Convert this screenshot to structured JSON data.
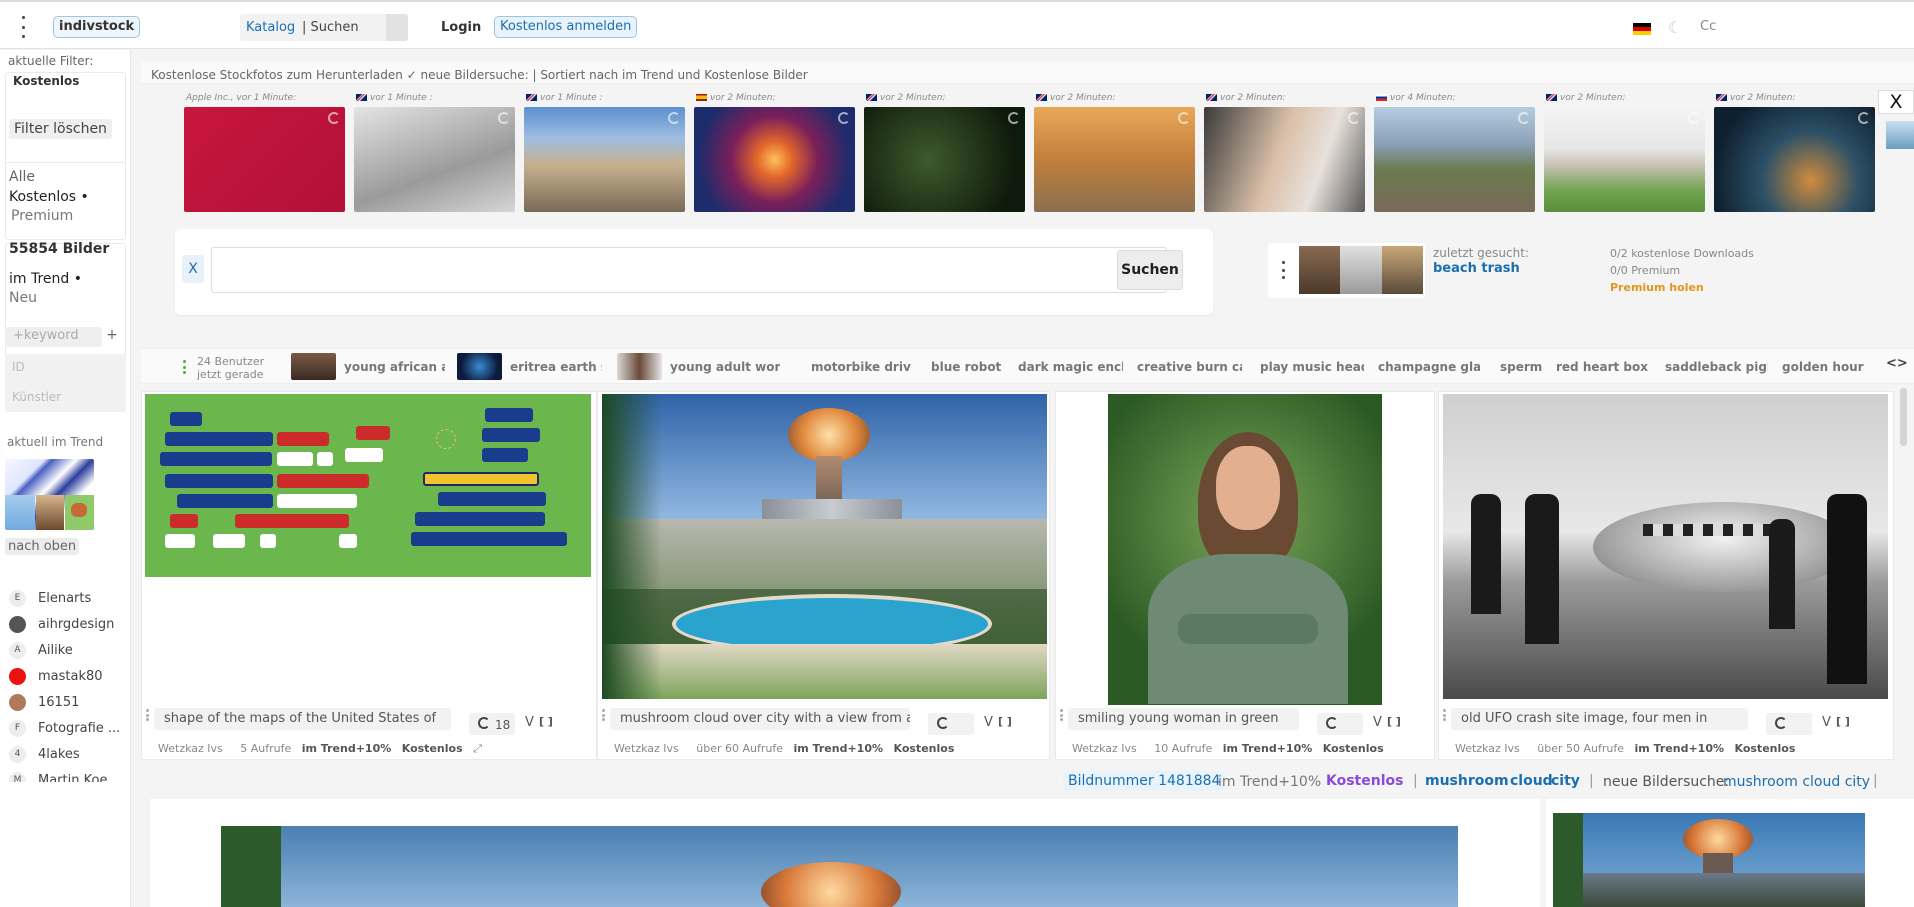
{
  "topbar": {
    "logo": "indivstock",
    "catalog_label": "Katalog",
    "search_label": "| Suchen",
    "login_label": "Login",
    "signup_label": "Kostenlos anmelden",
    "theme_icon": "moon-icon",
    "cc_label": "Cc",
    "flag_colors": [
      "#000000",
      "#dd0000",
      "#ffce00"
    ]
  },
  "sidebar": {
    "filter_title": "aktuelle Filter:",
    "filter_value": "Kostenlos",
    "filter_clear": "Filter löschen",
    "types": [
      "Alle",
      "Kostenlos •",
      "Premium"
    ],
    "count": "55854 Bilder",
    "sorts": [
      "im Trend •",
      "Neu"
    ],
    "keyword_placeholder": "+keyword",
    "plus": "+",
    "id_placeholder": "ID",
    "artist_placeholder": "Künstler",
    "trend_label": "aktuell im Trend",
    "to_top": "nach oben",
    "artists": [
      {
        "initial": "E",
        "name": "Elenarts",
        "color": "#ededed"
      },
      {
        "initial": "",
        "name": "aihrgdesign",
        "color": "#555555"
      },
      {
        "initial": "A",
        "name": "Ailike",
        "color": "#ededed"
      },
      {
        "initial": "",
        "name": "mastak80",
        "color": "#ee1111"
      },
      {
        "initial": "",
        "name": "16151",
        "color": "#b07a5a"
      },
      {
        "initial": "F",
        "name": "Fotografie ...",
        "color": "#ededed"
      },
      {
        "initial": "4",
        "name": "4lakes",
        "color": "#ededed"
      },
      {
        "initial": "M",
        "name": "Martin Koe...",
        "color": "#ededed"
      }
    ]
  },
  "main": {
    "head_text": "Kostenlose Stockfotos zum Herunterladen ✓ neue Bildersuche: | Sortiert nach im Trend und Kostenlose Bilder"
  },
  "recent": [
    {
      "caption": "Apple Inc., vor 1 Minute:",
      "flag": "",
      "bg": "linear-gradient(135deg,#c7163f,#b21038)"
    },
    {
      "caption": "vor 1 Minute :",
      "flag": "uk",
      "bg": "linear-gradient(160deg,#e4e4e4,#9a9a9a 60%,#d6d6d6)"
    },
    {
      "caption": "vor 1 Minute :",
      "flag": "uk",
      "bg": "linear-gradient(#5c8fcf 0%,#9ebde0 30%,#c6b08e 55%,#7a6a58 100%)"
    },
    {
      "caption": "vor 2 Minuten:",
      "flag": "es",
      "bg": "radial-gradient(circle at 50% 50%,#ffc060 0%,#e4682a 18%,#7a1f5a 45%,#1c2c6c 80%)"
    },
    {
      "caption": "vor 2 Minuten:",
      "flag": "uk",
      "bg": "radial-gradient(circle at 40% 50%,#3e5a2c,#0e1a0c 80%)"
    },
    {
      "caption": "vor 2 Minuten:",
      "flag": "uk",
      "bg": "linear-gradient(#e8a858 0%,#c27e3c 50%,#8b7050 100%)"
    },
    {
      "caption": "vor 2 Minuten:",
      "flag": "uk",
      "bg": "linear-gradient(110deg,#3a3a3a,#d9bfa8 45%,#e8e1db 70%,#5a5a5a)"
    },
    {
      "caption": "vor 4 Minuten:",
      "flag": "ru",
      "bg": "linear-gradient(#b6ccdf 0%,#8aa1b8 35%,#6b7a4e 60%,#7a6a5a 100%)"
    },
    {
      "caption": "vor 2 Minuten:",
      "flag": "uk",
      "bg": "linear-gradient(#f4f4f4 0%,#e6e6e6 40%,#c9c2b5 55%,#6fa34e 80%,#5c8f3c 100%)"
    },
    {
      "caption": "vor 2 Minuten:",
      "flag": "uk",
      "bg": "radial-gradient(circle at 60% 70%,#d08c3c 0%,#2c5066 40%,#0e2030 80%)"
    }
  ],
  "strip_close": "X",
  "search": {
    "clear": "X",
    "placeholder": "",
    "button": "Suchen"
  },
  "recent_search": {
    "title": "zuletzt gesucht:",
    "query": "beach trash",
    "downloads_free": "0/2 kostenlose Downloads",
    "downloads_premium": "0/0 Premium",
    "get_premium": "Premium holen"
  },
  "keyword_row": {
    "users_now": "24 Benutzer",
    "users_now2": "jetzt gerade",
    "expand": "<>",
    "keywords": [
      {
        "text": "young african ar",
        "img": "linear-gradient(#7b5a44,#3a2a22)"
      },
      {
        "text": "eritrea earth spa",
        "img": "radial-gradient(circle,#3a8ad0,#0c1a3c 70%)"
      },
      {
        "text": "young adult wor",
        "img": "linear-gradient(90deg,#d8d8d8,#6b4a38,#e6e6e6)"
      },
      {
        "text": "motorbike drive",
        "img": ""
      },
      {
        "text": "blue robot",
        "img": ""
      },
      {
        "text": "dark magic ench",
        "img": ""
      },
      {
        "text": "creative burn ca",
        "img": ""
      },
      {
        "text": "play music head",
        "img": ""
      },
      {
        "text": "champagne glas",
        "img": ""
      },
      {
        "text": "sperm",
        "img": ""
      },
      {
        "text": "red heart box",
        "img": ""
      },
      {
        "text": "saddleback pigle",
        "img": ""
      },
      {
        "text": "golden hour",
        "img": ""
      }
    ]
  },
  "cards": [
    {
      "title": "shape of the maps of the United States of",
      "refresh_count": "18",
      "v": "V",
      "fs": "[ ]",
      "author": "Wetzkaz Ivs",
      "views": "5 Aufrufe",
      "trend": "im Trend+10%",
      "license": "Kostenlos",
      "expand": "⤢"
    },
    {
      "title": "mushroom cloud over city with a view from a",
      "refresh_count": "",
      "v": "V",
      "fs": "[ ]",
      "author": "Wetzkaz Ivs",
      "views": "über 60 Aufrufe",
      "trend": "im Trend+10%",
      "license": "Kostenlos",
      "expand": ""
    },
    {
      "title": "smiling young woman in green",
      "refresh_count": "",
      "v": "V",
      "fs": "[ ]",
      "author": "Wetzkaz Ivs",
      "views": "10 Aufrufe",
      "trend": "im Trend+10%",
      "license": "Kostenlos",
      "expand": ""
    },
    {
      "title": "old UFO crash site image, four men in",
      "refresh_count": "",
      "v": "V",
      "fs": "[ ]",
      "author": "Wetzkaz Ivs",
      "views": "über 50 Aufrufe",
      "trend": "im Trend+10%",
      "license": "Kostenlos",
      "expand": ""
    }
  ],
  "detail": {
    "bildnummer": "Bildnummer 1481884",
    "trend": "im Trend+10%",
    "license": "Kostenlos",
    "sep": "|",
    "keywords": [
      "mushroom",
      "cloud",
      "city"
    ],
    "new_search_label": "neue Bildersuche:",
    "new_search_link": "mushroom cloud city"
  }
}
